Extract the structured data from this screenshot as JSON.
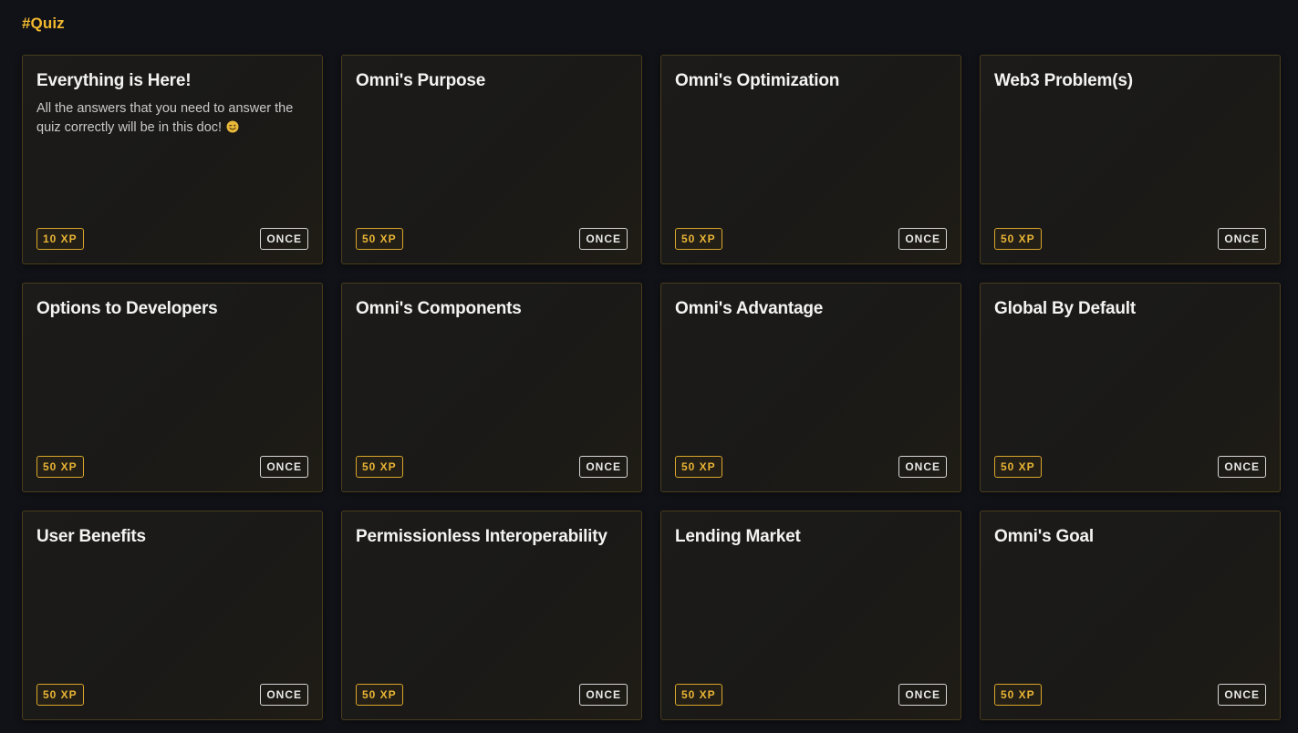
{
  "section": {
    "title": "#Quiz"
  },
  "colors": {
    "accent": "#f2b92f",
    "background": "#111217",
    "card_border": "#4a3d1e",
    "once_border": "#d6d6d6"
  },
  "cards": [
    {
      "title": "Everything is Here!",
      "description": "All the answers that you need to answer the quiz correctly will be in this doc!",
      "emoji": "winking-face-icon",
      "xp": "10 XP",
      "frequency": "ONCE"
    },
    {
      "title": "Omni's Purpose",
      "xp": "50 XP",
      "frequency": "ONCE"
    },
    {
      "title": "Omni's Optimization",
      "xp": "50 XP",
      "frequency": "ONCE"
    },
    {
      "title": "Web3 Problem(s)",
      "xp": "50 XP",
      "frequency": "ONCE"
    },
    {
      "title": "Options to Developers",
      "xp": "50 XP",
      "frequency": "ONCE"
    },
    {
      "title": "Omni's Components",
      "xp": "50 XP",
      "frequency": "ONCE"
    },
    {
      "title": "Omni's Advantage",
      "xp": "50 XP",
      "frequency": "ONCE"
    },
    {
      "title": "Global By Default",
      "xp": "50 XP",
      "frequency": "ONCE"
    },
    {
      "title": "User Benefits",
      "xp": "50 XP",
      "frequency": "ONCE"
    },
    {
      "title": "Permissionless Interoperability",
      "xp": "50 XP",
      "frequency": "ONCE"
    },
    {
      "title": "Lending Market",
      "xp": "50 XP",
      "frequency": "ONCE"
    },
    {
      "title": "Omni's Goal",
      "xp": "50 XP",
      "frequency": "ONCE"
    }
  ]
}
